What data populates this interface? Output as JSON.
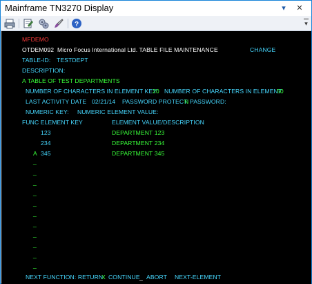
{
  "window": {
    "title": "Mainframe TN3270 Display"
  },
  "titlebar_buttons": {
    "pin": "▾",
    "close": "✕"
  },
  "toolbar": {
    "tools": [
      {
        "name": "print-icon",
        "color": "#5a6a80"
      },
      {
        "name": "edit-icon",
        "color": "#3d7a3d"
      },
      {
        "name": "settings-icon",
        "color": "#6b6b9c"
      },
      {
        "name": "brush-icon",
        "color": "#8a4ea0"
      },
      {
        "name": "help-icon",
        "color": "#2c62c4"
      }
    ],
    "overflow": "▾"
  },
  "screen": {
    "program": "MFDEMO",
    "header_id": "OTDEM092",
    "header_title": "Micro Focus International Ltd. TABLE FILE MAINTENANCE",
    "header_mode": "CHANGE",
    "table_id_label": "TABLE-ID:",
    "table_id_value": "TESTDEPT",
    "description_label": "DESCRIPTION:",
    "description_value": "A TABLE OF TEST DEPARTMENTS",
    "key_chars_label": "NUMBER OF CHARACTERS IN ELEMENT KEY:",
    "key_chars_value": "20",
    "element_chars_label": "NUMBER OF CHARACTERS IN ELEMENT:",
    "element_chars_value": "50",
    "last_activity_label": "LAST ACTIVITY DATE",
    "last_activity_value": "02/21/14",
    "password_protect_label": "PASSWORD PROTECT:",
    "password_protect_value": "N",
    "password_label": "PASSWORD:",
    "numeric_key_label": "NUMERIC KEY:",
    "numeric_element_label": "NUMERIC ELEMENT VALUE:",
    "column_header_left": "FUNC ELEMENT KEY",
    "column_header_right": "ELEMENT VALUE/DESCRIPTION",
    "rows": [
      {
        "func": "",
        "key": "123",
        "value": "DEPARTMENT 123"
      },
      {
        "func": "",
        "key": "234",
        "value": "DEPARTMENT 234"
      },
      {
        "func": "A",
        "key": "345",
        "value": "DEPARTMENT 345"
      }
    ],
    "blank_func_marker": "_",
    "footer_label": "NEXT FUNCTION: RETURN",
    "footer_x": "X",
    "footer_continue": "CONTINUE",
    "footer_blank": "_",
    "footer_abort": "ABORT",
    "footer_next_element": "NEXT-ELEMENT"
  }
}
